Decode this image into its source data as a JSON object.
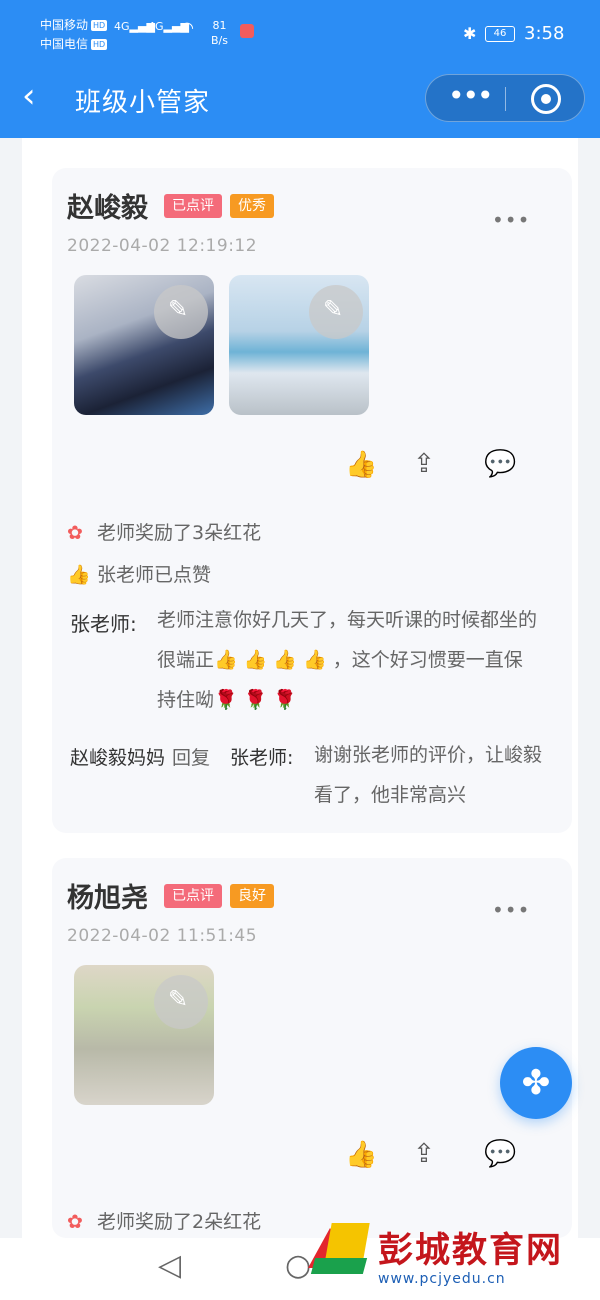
{
  "status_bar": {
    "carrier1": "中国移动",
    "carrier2": "中国电信",
    "hd": "HD",
    "net1": "4G",
    "net2": "4G",
    "speed_value": "81",
    "speed_unit": "B/s",
    "battery": "46",
    "time": "3:58"
  },
  "navbar": {
    "title": "班级小管家",
    "more_label": "•••"
  },
  "posts": [
    {
      "name": "赵峻毅",
      "tags": [
        "已点评",
        "优秀"
      ],
      "timestamp": "2022-04-02 12:19:12",
      "reward": "老师奖励了3朵红花",
      "liked_by": "张老师已点赞",
      "comments": [
        {
          "author": "张老师:",
          "text": "老师注意你好几天了，每天听课的时候都坐的很端正👍 👍 👍 👍 ，这个好习惯要一直保持住呦🌹 🌹 🌹"
        },
        {
          "author": "赵峻毅妈妈",
          "reply_word": "回复",
          "target": "张老师:",
          "text": "谢谢张老师的评价，让峻毅看了，他非常高兴"
        }
      ]
    },
    {
      "name": "杨旭尧",
      "tags": [
        "已点评",
        "良好"
      ],
      "timestamp": "2022-04-02 11:51:45",
      "reward": "老师奖励了2朵红花"
    }
  ],
  "watermark": {
    "text": "彭城教育网",
    "url": "www.pcjyedu.cn"
  },
  "icons": {
    "back": "chevron-left-icon",
    "edit": "pencil-icon",
    "like": "thumbs-up-icon",
    "share": "share-icon",
    "comment": "comment-icon",
    "fab": "four-leaf-menu-icon"
  },
  "colors": {
    "brand": "#2c8df4",
    "tag_red": "#f46b7a",
    "tag_orange": "#f79a22"
  }
}
